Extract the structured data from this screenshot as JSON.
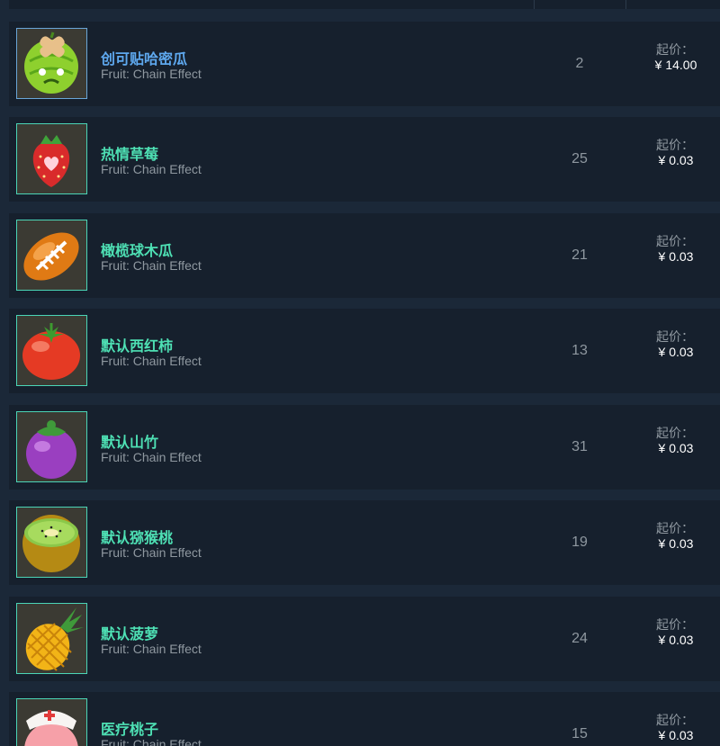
{
  "listings": [
    {
      "name": "创可贴哈密瓜",
      "subtitle": "Fruit: Chain Effect",
      "quantity": "2",
      "price_label": "起价：",
      "price": "¥ 14.00",
      "name_color": "#5ea8ee",
      "icon": "melon-icon"
    },
    {
      "name": "热情草莓",
      "subtitle": "Fruit: Chain Effect",
      "quantity": "25",
      "price_label": "起价：",
      "price": "¥ 0.03",
      "name_color": "#4ee0b4",
      "icon": "strawberry-icon"
    },
    {
      "name": "橄榄球木瓜",
      "subtitle": "Fruit: Chain Effect",
      "quantity": "21",
      "price_label": "起价：",
      "price": "¥ 0.03",
      "name_color": "#4ee0b4",
      "icon": "papaya-football-icon"
    },
    {
      "name": "默认西红柿",
      "subtitle": "Fruit: Chain Effect",
      "quantity": "13",
      "price_label": "起价：",
      "price": "¥ 0.03",
      "name_color": "#4ee0b4",
      "icon": "tomato-icon"
    },
    {
      "name": "默认山竹",
      "subtitle": "Fruit: Chain Effect",
      "quantity": "31",
      "price_label": "起价：",
      "price": "¥ 0.03",
      "name_color": "#4ee0b4",
      "icon": "mangosteen-icon"
    },
    {
      "name": "默认猕猴桃",
      "subtitle": "Fruit: Chain Effect",
      "quantity": "19",
      "price_label": "起价：",
      "price": "¥ 0.03",
      "name_color": "#4ee0b4",
      "icon": "kiwi-icon"
    },
    {
      "name": "默认菠萝",
      "subtitle": "Fruit: Chain Effect",
      "quantity": "24",
      "price_label": "起价：",
      "price": "¥ 0.03",
      "name_color": "#4ee0b4",
      "icon": "pineapple-icon"
    },
    {
      "name": "医疗桃子",
      "subtitle": "Fruit: Chain Effect",
      "quantity": "15",
      "price_label": "起价：",
      "price": "¥ 0.03",
      "name_color": "#4ee0b4",
      "icon": "peach-nurse-icon"
    }
  ]
}
